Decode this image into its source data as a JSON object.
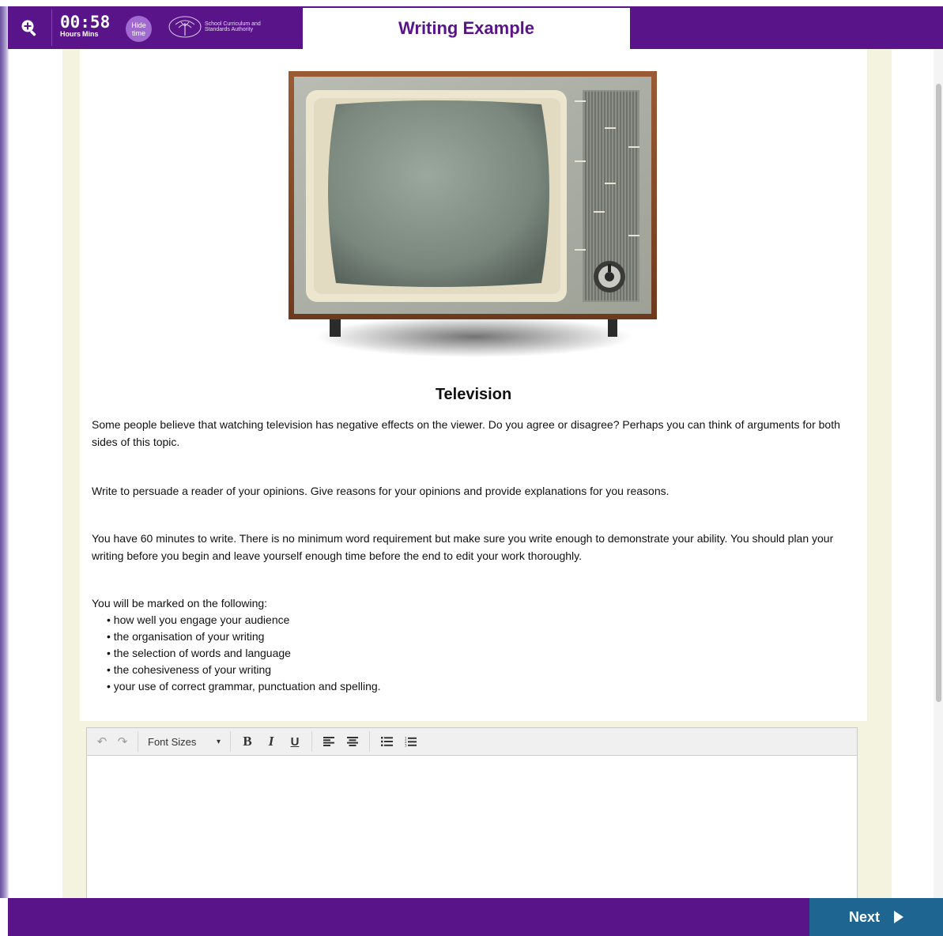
{
  "header": {
    "timer": {
      "time": "00:58",
      "hours_label": "Hours",
      "mins_label": "Mins"
    },
    "hide_time_label": "Hide time",
    "logo_text": "School Curriculum and Standards Authority",
    "title": "Writing Example",
    "colors": {
      "primary": "#5a148a",
      "accent": "#a16ad0"
    }
  },
  "prompt": {
    "title": "Television",
    "paragraphs": [
      "Some people believe that watching television has negative effects on the viewer. Do you agree or disagree? Perhaps you can think of arguments for both sides of this topic.",
      "Write to persuade a reader of your opinions. Give reasons for your opinions and provide explanations for you reasons.",
      "You have 60 minutes to write. There is no minimum word requirement but make sure you write enough to demonstrate your ability. You should plan your writing before you begin and leave yourself enough time before the end to edit your work thoroughly."
    ],
    "criteria_intro": "You will be marked on the following:",
    "criteria": [
      "how well you engage your audience",
      "the organisation of your writing",
      "the selection of words and language",
      "the cohesiveness of your writing",
      "your use of correct grammar, punctuation and spelling."
    ]
  },
  "editor": {
    "font_sizes_label": "Font Sizes",
    "content": ""
  },
  "footer": {
    "next_label": "Next",
    "next_color": "#1f6592"
  }
}
